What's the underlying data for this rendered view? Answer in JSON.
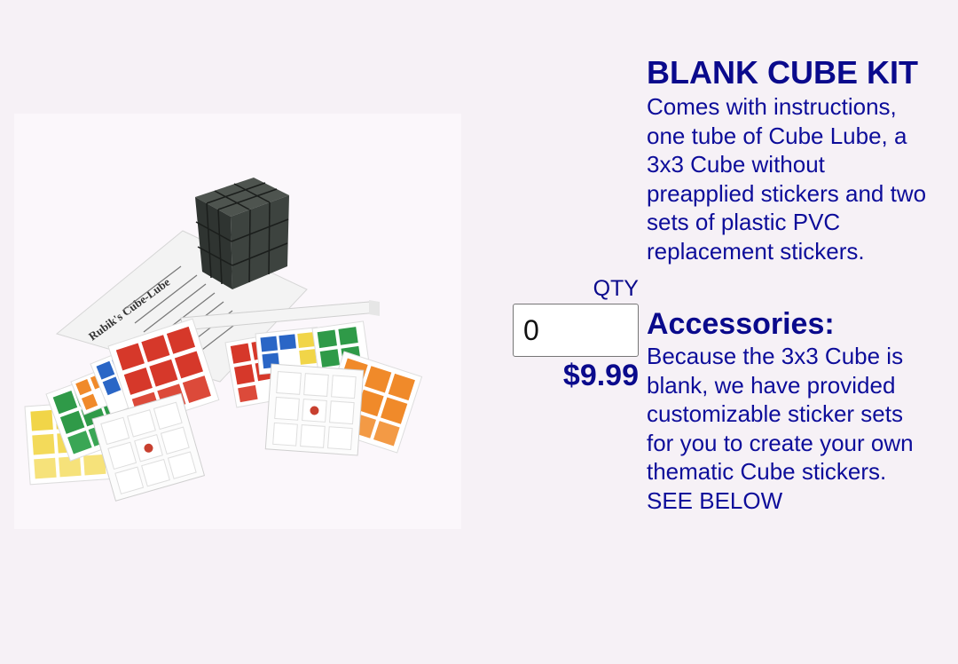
{
  "product": {
    "title": "BLANK CUBE KIT",
    "description": "Comes with instructions, one tube of Cube Lube, a 3x3 Cube without preapplied stickers and two sets of plastic PVC replacement stickers.",
    "image_label": "Rubik's Cube-Lube",
    "qty_label": "QTY",
    "qty_value": "0",
    "price": "$9.99"
  },
  "accessories": {
    "heading": "Accessories:",
    "text": "Because the 3x3 Cube is blank, we have provided customizable sticker sets for you to create your own thematic Cube stickers.",
    "link": "SEE BELOW"
  },
  "colors": {
    "text": "#0a0a8c",
    "background": "#f6f1f6"
  }
}
